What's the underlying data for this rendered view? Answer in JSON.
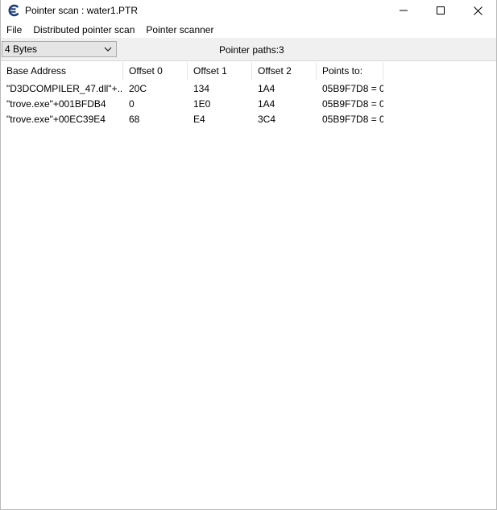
{
  "window": {
    "title": "Pointer scan : water1.PTR",
    "icon": "cheat-engine-icon"
  },
  "menu": {
    "file": "File",
    "distributed": "Distributed pointer scan",
    "scanner": "Pointer scanner"
  },
  "toolbar": {
    "type_selected": "4 Bytes",
    "paths_label": "Pointer paths:",
    "paths_count": "3"
  },
  "table": {
    "columns": [
      "Base Address",
      "Offset 0",
      "Offset 1",
      "Offset 2",
      "Points to:"
    ],
    "rows": [
      [
        "\"D3DCOMPILER_47.dll\"+...",
        "20C",
        "134",
        "1A4",
        "05B9F7D8 = 0"
      ],
      [
        "\"trove.exe\"+001BFDB4",
        "0",
        "1E0",
        "1A4",
        "05B9F7D8 = 0"
      ],
      [
        "\"trove.exe\"+00EC39E4",
        "68",
        "E4",
        "3C4",
        "05B9F7D8 = 0"
      ]
    ]
  },
  "colors": {
    "toolbar_bg": "#f0f0f0",
    "icon_blue": "#1f3d7a"
  }
}
